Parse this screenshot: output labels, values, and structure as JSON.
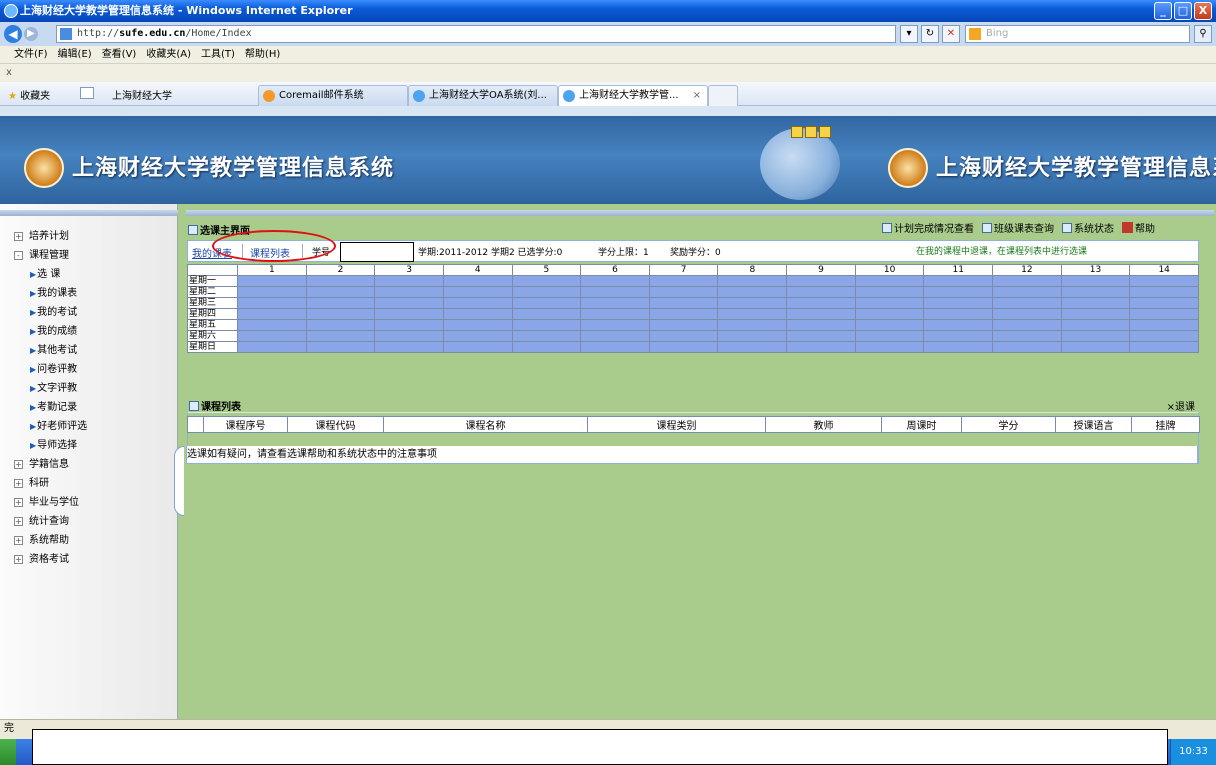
{
  "window": {
    "title": "上海财经大学教学管理信息系统 - Windows Internet Explorer",
    "controls": {
      "minimize": "_",
      "maximize": "□",
      "close": "X"
    }
  },
  "address_bar": {
    "url_prefix": "http://",
    "url_domain": "sufe.edu.cn",
    "url_suffix": "/Home/Index",
    "search_placeholder": "Bing"
  },
  "menu": [
    "文件(F)",
    "编辑(E)",
    "查看(V)",
    "收藏夹(A)",
    "工具(T)",
    "帮助(H)"
  ],
  "command_bar": "x",
  "favorites": {
    "label": "收藏夹",
    "link": "上海财经大学"
  },
  "tabs": [
    {
      "label": "Coremail邮件系统",
      "icon": "mail-icon"
    },
    {
      "label": "上海财经大学OA系统(刘...",
      "icon": "ie-icon"
    },
    {
      "label": "上海财经大学教学管...",
      "icon": "ie-icon",
      "active": true,
      "close": "×"
    }
  ],
  "banner": {
    "title": "上海财经大学教学管理信息系统",
    "title_repeat": "上海财经大学教学管理信息系"
  },
  "sidebar": {
    "items": [
      {
        "label": "培养计划",
        "toggle": "+",
        "expanded": false
      },
      {
        "label": "课程管理",
        "toggle": "-",
        "expanded": true,
        "children": [
          "选  课",
          "我的课表",
          "我的考试",
          "我的成绩",
          "其他考试",
          "问卷评教",
          "文字评教",
          "考勤记录",
          "好老师评选",
          "导师选择"
        ]
      },
      {
        "label": "学籍信息",
        "toggle": "+"
      },
      {
        "label": "科研",
        "toggle": "+"
      },
      {
        "label": "毕业与学位",
        "toggle": "+"
      },
      {
        "label": "统计查询",
        "toggle": "+"
      },
      {
        "label": "系统帮助",
        "toggle": "+"
      },
      {
        "label": "资格考试",
        "toggle": "+"
      }
    ]
  },
  "main": {
    "section_title": "选课主界面",
    "top_links": [
      "计划完成情况查看",
      "班级课表查询",
      "系统状态",
      "帮助"
    ],
    "tab_my_schedule": "我的课表",
    "tab_course_list": "课程列表",
    "student_label": "学号",
    "term_text": "学期:2011-2012 学期2 已选学分:0",
    "credit_limit": "学分上限：1",
    "bonus_credit": "奖励学分：0",
    "hint": "在我的课程中退课，在课程列表中进行选课",
    "periods": [
      "1",
      "2",
      "3",
      "4",
      "5",
      "6",
      "7",
      "8",
      "9",
      "10",
      "11",
      "12",
      "13",
      "14"
    ],
    "days": [
      "星期一",
      "星期二",
      "星期三",
      "星期四",
      "星期五",
      "星期六",
      "星期日"
    ],
    "course_list_title": "课程列表",
    "withdraw_button": "×退课",
    "course_columns": [
      "课程序号",
      "课程代码",
      "课程名称",
      "课程类别",
      "教师",
      "周课时",
      "学分",
      "授课语言",
      "挂牌"
    ],
    "course_note": "选课如有疑问，请查看选课帮助和系统状态中的注意事项"
  },
  "status": {
    "text": "完",
    "clock": "10:33"
  },
  "colors": {
    "page_background": "#a9cc8c",
    "banner_blue": "#2c5f99",
    "timetable_cell": "#8ba6e6",
    "highlight_oval": "#e01010",
    "hint_green": "#1a7a1a"
  }
}
